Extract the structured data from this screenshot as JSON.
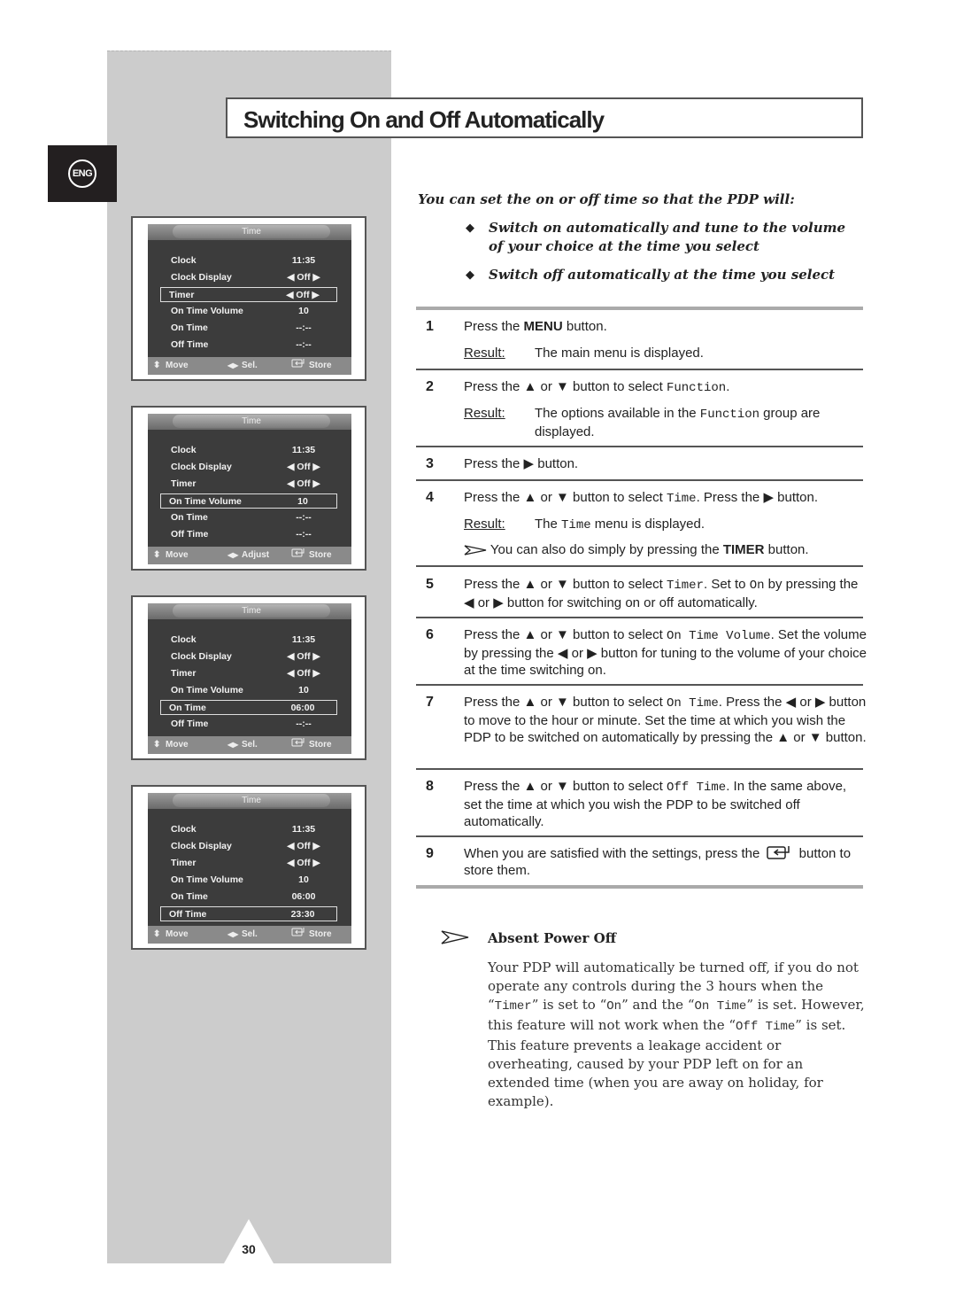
{
  "page": {
    "title": "Switching On and Off Automatically",
    "language_badge": "ENG",
    "page_number": "30"
  },
  "intro": {
    "lead": "You can set the on or off time so that the PDP will:",
    "bullets": [
      "Switch on automatically and tune to the volume of your choice at the time you select",
      "Switch off automatically at the time you select"
    ]
  },
  "osd_screens": [
    {
      "title": "Time",
      "selected_row": 2,
      "rows": [
        {
          "label": "Clock",
          "value": "11:35"
        },
        {
          "label": "Clock Display",
          "value": "◀  Off  ▶"
        },
        {
          "label": "Timer",
          "value": "◀  Off  ▶"
        },
        {
          "label": "On Time Volume",
          "value": "10"
        },
        {
          "label": "On Time",
          "value": "--:--"
        },
        {
          "label": "Off Time",
          "value": "--:--"
        }
      ],
      "footer": {
        "move": "Move",
        "middle": "Sel.",
        "store": "Store"
      }
    },
    {
      "title": "Time",
      "selected_row": 3,
      "rows": [
        {
          "label": "Clock",
          "value": "11:35"
        },
        {
          "label": "Clock Display",
          "value": "◀  Off  ▶"
        },
        {
          "label": "Timer",
          "value": "◀  Off  ▶"
        },
        {
          "label": "On Time Volume",
          "value": "10"
        },
        {
          "label": "On Time",
          "value": "--:--"
        },
        {
          "label": "Off Time",
          "value": "--:--"
        }
      ],
      "footer": {
        "move": "Move",
        "middle": "Adjust",
        "store": "Store"
      }
    },
    {
      "title": "Time",
      "selected_row": 4,
      "rows": [
        {
          "label": "Clock",
          "value": "11:35"
        },
        {
          "label": "Clock Display",
          "value": "◀  Off  ▶"
        },
        {
          "label": "Timer",
          "value": "◀  Off  ▶"
        },
        {
          "label": "On Time Volume",
          "value": "10"
        },
        {
          "label": "On Time",
          "value": "06:00"
        },
        {
          "label": "Off Time",
          "value": "--:--"
        }
      ],
      "footer": {
        "move": "Move",
        "middle": "Sel.",
        "store": "Store"
      }
    },
    {
      "title": "Time",
      "selected_row": 5,
      "rows": [
        {
          "label": "Clock",
          "value": "11:35"
        },
        {
          "label": "Clock Display",
          "value": "◀  Off  ▶"
        },
        {
          "label": "Timer",
          "value": "◀  Off  ▶"
        },
        {
          "label": "On Time Volume",
          "value": "10"
        },
        {
          "label": "On Time",
          "value": "06:00"
        },
        {
          "label": "Off Time",
          "value": "23:30"
        }
      ],
      "footer": {
        "move": "Move",
        "middle": "Sel.",
        "store": "Store"
      }
    }
  ],
  "steps": {
    "result_label": "Result:",
    "s1": {
      "num": "1",
      "a": "Press the ",
      "b": "MENU",
      "c": " button.",
      "result": "The main menu is displayed."
    },
    "s2": {
      "num": "2",
      "a": "Press the ▲ or ▼ button to select ",
      "m": "Function",
      "c": ".",
      "result_a": "The options available in the ",
      "result_m": "Function",
      "result_c": " group are displayed."
    },
    "s3": {
      "num": "3",
      "text": "Press the ▶ button."
    },
    "s4": {
      "num": "4",
      "a": "Press the ▲ or ▼ button to select ",
      "m": "Time",
      "c": ". Press the ▶ button.",
      "result_a": "The ",
      "result_m": "Time",
      "result_c": " menu is displayed.",
      "note_a": "You can also do simply by pressing the ",
      "note_b": "TIMER",
      "note_c": " button."
    },
    "s5": {
      "num": "5",
      "a": "Press the ▲ or ▼ button to select ",
      "m1": "Timer",
      "b": ". Set to ",
      "m2": "On",
      "c": " by pressing the ◀ or ▶ button for switching on or off automatically."
    },
    "s6": {
      "num": "6",
      "a": "Press the ▲ or ▼ button to select ",
      "m": "On Time Volume",
      "c": ". Set the volume by pressing the ◀ or ▶ button for tuning to the volume of your choice at the time switching on."
    },
    "s7": {
      "num": "7",
      "a": "Press the ▲ or ▼ button to select ",
      "m": "On Time",
      "c": ". Press the ◀ or ▶ button to move to the hour or minute. Set the time at which you wish the PDP to be switched on automatically by pressing the ▲ or ▼ button."
    },
    "s8": {
      "num": "8",
      "a": "Press the ▲ or ▼ button to select ",
      "m": "Off Time",
      "c": ". In the same above, set the time at which you wish the PDP to be switched off automatically."
    },
    "s9": {
      "num": "9",
      "a": "When you are satisfied with the settings, press the ",
      "c": " button to store them."
    }
  },
  "absent_power_off": {
    "heading": "Absent Power Off",
    "p1": "Your PDP will automatically be turned off, if you do not operate any controls during the 3 hours when the “",
    "m1": "Timer",
    "p2": "” is set to “",
    "m2": "On",
    "p3": "” and the “",
    "m3": "On Time",
    "p4": "” is set. However, this feature will not work when the “",
    "m4": "Off Time",
    "p5": "” is set.",
    "p6": "This feature prevents a leakage accident or overheating, caused by your PDP left on for an extended time (when you are away on holiday, for example)."
  }
}
